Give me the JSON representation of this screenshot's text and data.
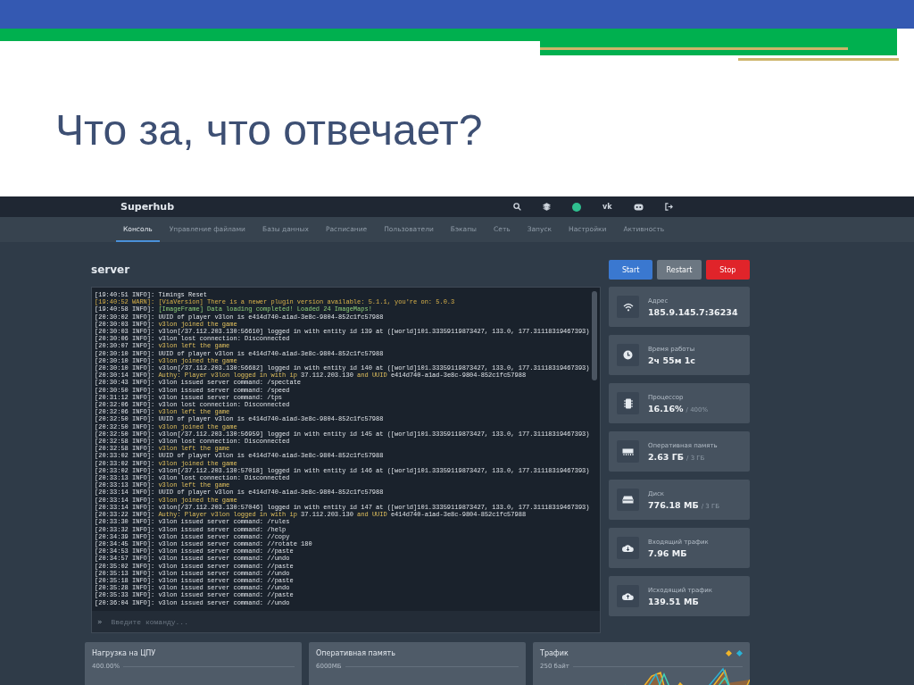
{
  "slide": {
    "title": "Что за, что отвечает?"
  },
  "header": {
    "brand": "Superhub",
    "vk_label": "vk"
  },
  "tabs": [
    {
      "label": "Консоль",
      "selected": true
    },
    {
      "label": "Управление файлами",
      "selected": false
    },
    {
      "label": "Базы данных",
      "selected": false
    },
    {
      "label": "Расписание",
      "selected": false
    },
    {
      "label": "Пользователи",
      "selected": false
    },
    {
      "label": "Бэкапы",
      "selected": false
    },
    {
      "label": "Сеть",
      "selected": false
    },
    {
      "label": "Запуск",
      "selected": false
    },
    {
      "label": "Настройки",
      "selected": false
    },
    {
      "label": "Активность",
      "selected": false
    }
  ],
  "server_name": "server",
  "buttons": [
    {
      "label": "Start",
      "kind": "start"
    },
    {
      "label": "Restart",
      "kind": "restart"
    },
    {
      "label": "Stop",
      "kind": "stop"
    }
  ],
  "console": {
    "prompt": "»",
    "placeholder": "Введите команду...",
    "lines": [
      [
        {
          "text": "[19:40:51 INFO]: Timings Reset",
          "kind": "plain"
        }
      ],
      [
        {
          "text": "[19:40:52 WARN]: [ViaVersion] There is a newer plugin version available: 5.1.1, you're on: 5.0.3",
          "kind": "warn"
        }
      ],
      [
        {
          "text": "[19:40:58 INFO]: ",
          "kind": "plain"
        },
        {
          "text": "[ImageFrame] Data loading completed! Loaded 24 ImageMaps!",
          "kind": "green"
        }
      ],
      [
        {
          "text": "[20:30:02 INFO]: UUID of player v3lon is e414d740-a1ad-3e8c-9804-852c1fc57988",
          "kind": "plain"
        }
      ],
      [
        {
          "text": "[20:30:03 INFO]: ",
          "kind": "plain"
        },
        {
          "text": "v3lon joined the game",
          "kind": "yellow"
        }
      ],
      [
        {
          "text": "[20:30:03 INFO]: v3lon[/37.112.203.130:56610] logged in with entity id 139 at ([world]101.33359119873427, 133.0, 177.31118319467393)",
          "kind": "plain"
        }
      ],
      [
        {
          "text": "[20:30:06 INFO]: v3lon lost connection: Disconnected",
          "kind": "plain"
        }
      ],
      [
        {
          "text": "[20:30:07 INFO]: ",
          "kind": "plain"
        },
        {
          "text": "v3lon left the game",
          "kind": "yellow"
        }
      ],
      [
        {
          "text": "[20:30:10 INFO]: UUID of player v3lon is e414d740-a1ad-3e8c-9804-852c1fc57988",
          "kind": "plain"
        }
      ],
      [
        {
          "text": "[20:30:10 INFO]: ",
          "kind": "plain"
        },
        {
          "text": "v3lon joined the game",
          "kind": "yellow"
        }
      ],
      [
        {
          "text": "[20:30:10 INFO]: v3lon[/37.112.203.130:56682] logged in with entity id 140 at ([world]101.33359119873427, 133.0, 177.31118319467393)",
          "kind": "plain"
        }
      ],
      [
        {
          "text": "[20:30:14 INFO]: ",
          "kind": "plain"
        },
        {
          "text": "Authy: Player v3lon logged in with ip",
          "kind": "yellow"
        },
        {
          "text": " 37.112.203.130 ",
          "kind": "plain"
        },
        {
          "text": "and UUID",
          "kind": "yellow"
        },
        {
          "text": " e414d740-a1ad-3e8c-9804-852c1fc57988",
          "kind": "plain"
        }
      ],
      [
        {
          "text": "[20:30:43 INFO]: v3lon issued server command: /spectate",
          "kind": "plain"
        }
      ],
      [
        {
          "text": "[20:30:50 INFO]: v3lon issued server command: /speed",
          "kind": "plain"
        }
      ],
      [
        {
          "text": "[20:31:12 INFO]: v3lon issued server command: /tps",
          "kind": "plain"
        }
      ],
      [
        {
          "text": "[20:32:06 INFO]: v3lon lost connection: Disconnected",
          "kind": "plain"
        }
      ],
      [
        {
          "text": "[20:32:06 INFO]: ",
          "kind": "plain"
        },
        {
          "text": "v3lon left the game",
          "kind": "yellow"
        }
      ],
      [
        {
          "text": "[20:32:50 INFO]: UUID of player v3lon is e414d740-a1ad-3e8c-9804-852c1fc57988",
          "kind": "plain"
        }
      ],
      [
        {
          "text": "[20:32:50 INFO]: ",
          "kind": "plain"
        },
        {
          "text": "v3lon joined the game",
          "kind": "yellow"
        }
      ],
      [
        {
          "text": "[20:32:50 INFO]: v3lon[/37.112.203.130:56959] logged in with entity id 145 at ([world]101.33359119873427, 133.0, 177.31118319467393)",
          "kind": "plain"
        }
      ],
      [
        {
          "text": "[20:32:58 INFO]: v3lon lost connection: Disconnected",
          "kind": "plain"
        }
      ],
      [
        {
          "text": "[20:32:58 INFO]: ",
          "kind": "plain"
        },
        {
          "text": "v3lon left the game",
          "kind": "yellow"
        }
      ],
      [
        {
          "text": "[20:33:02 INFO]: UUID of player v3lon is e414d740-a1ad-3e8c-9804-852c1fc57988",
          "kind": "plain"
        }
      ],
      [
        {
          "text": "[20:33:02 INFO]: ",
          "kind": "plain"
        },
        {
          "text": "v3lon joined the game",
          "kind": "yellow"
        }
      ],
      [
        {
          "text": "[20:33:02 INFO]: v3lon[/37.112.203.130:57018] logged in with entity id 146 at ([world]101.33359119873427, 133.0, 177.31118319467393)",
          "kind": "plain"
        }
      ],
      [
        {
          "text": "[20:33:13 INFO]: v3lon lost connection: Disconnected",
          "kind": "plain"
        }
      ],
      [
        {
          "text": "[20:33:13 INFO]: ",
          "kind": "plain"
        },
        {
          "text": "v3lon left the game",
          "kind": "yellow"
        }
      ],
      [
        {
          "text": "[20:33:14 INFO]: UUID of player v3lon is e414d740-a1ad-3e8c-9804-852c1fc57988",
          "kind": "plain"
        }
      ],
      [
        {
          "text": "[20:33:14 INFO]: ",
          "kind": "plain"
        },
        {
          "text": "v3lon joined the game",
          "kind": "yellow"
        }
      ],
      [
        {
          "text": "[20:33:14 INFO]: v3lon[/37.112.203.130:57046] logged in with entity id 147 at ([world]101.33359119873427, 133.0, 177.31118319467393)",
          "kind": "plain"
        }
      ],
      [
        {
          "text": "[20:33:22 INFO]: ",
          "kind": "plain"
        },
        {
          "text": "Authy: Player v3lon logged in with ip",
          "kind": "yellow"
        },
        {
          "text": " 37.112.203.130 ",
          "kind": "plain"
        },
        {
          "text": "and UUID",
          "kind": "yellow"
        },
        {
          "text": " e414d740-a1ad-3e8c-9804-852c1fc57988",
          "kind": "plain"
        }
      ],
      [
        {
          "text": "[20:33:30 INFO]: v3lon issued server command: /rules",
          "kind": "plain"
        }
      ],
      [
        {
          "text": "[20:33:32 INFO]: v3lon issued server command: /help",
          "kind": "plain"
        }
      ],
      [
        {
          "text": "[20:34:39 INFO]: v3lon issued server command: //copy",
          "kind": "plain"
        }
      ],
      [
        {
          "text": "[20:34:45 INFO]: v3lon issued server command: //rotate 180",
          "kind": "plain"
        }
      ],
      [
        {
          "text": "[20:34:53 INFO]: v3lon issued server command: //paste",
          "kind": "plain"
        }
      ],
      [
        {
          "text": "[20:34:57 INFO]: v3lon issued server command: //undo",
          "kind": "plain"
        }
      ],
      [
        {
          "text": "[20:35:02 INFO]: v3lon issued server command: //paste",
          "kind": "plain"
        }
      ],
      [
        {
          "text": "[20:35:13 INFO]: v3lon issued server command: //undo",
          "kind": "plain"
        }
      ],
      [
        {
          "text": "[20:35:18 INFO]: v3lon issued server command: //paste",
          "kind": "plain"
        }
      ],
      [
        {
          "text": "[20:35:28 INFO]: v3lon issued server command: //undo",
          "kind": "plain"
        }
      ],
      [
        {
          "text": "[20:35:33 INFO]: v3lon issued server command: //paste",
          "kind": "plain"
        }
      ],
      [
        {
          "text": "[20:36:04 INFO]: v3lon issued server command: //undo",
          "kind": "plain"
        }
      ]
    ]
  },
  "stats": [
    {
      "kind": "wifi",
      "label": "Адрес",
      "value": "185.9.145.7:36234"
    },
    {
      "kind": "clock",
      "label": "Время работы",
      "value": "2ч 55м 1с"
    },
    {
      "kind": "chip",
      "label": "Процессор",
      "value": "16.16%",
      "limit": "/ 400%"
    },
    {
      "kind": "memory",
      "label": "Оперативная память",
      "value": "2.63 ГБ",
      "limit": "/ 3 ГБ"
    },
    {
      "kind": "disk",
      "label": "Диск",
      "value": "776.18 МБ",
      "limit": "/ 3 ГБ"
    },
    {
      "kind": "download",
      "label": "Входящий трафик",
      "value": "7.96 МБ"
    },
    {
      "kind": "upload",
      "label": "Исходящий трафик",
      "value": "139.51 МБ"
    }
  ],
  "charts": [
    {
      "kind": "cpu",
      "title": "Нагрузка на ЦПУ",
      "top_label": "400.00%"
    },
    {
      "kind": "ram",
      "title": "Оперативная память",
      "top_label": "6000МБ"
    },
    {
      "kind": "traffic",
      "title": "Трафик",
      "top_label": "250 байт",
      "legend": [
        {
          "color": "#f0b429"
        },
        {
          "color": "#2bb3d6"
        }
      ]
    }
  ]
}
